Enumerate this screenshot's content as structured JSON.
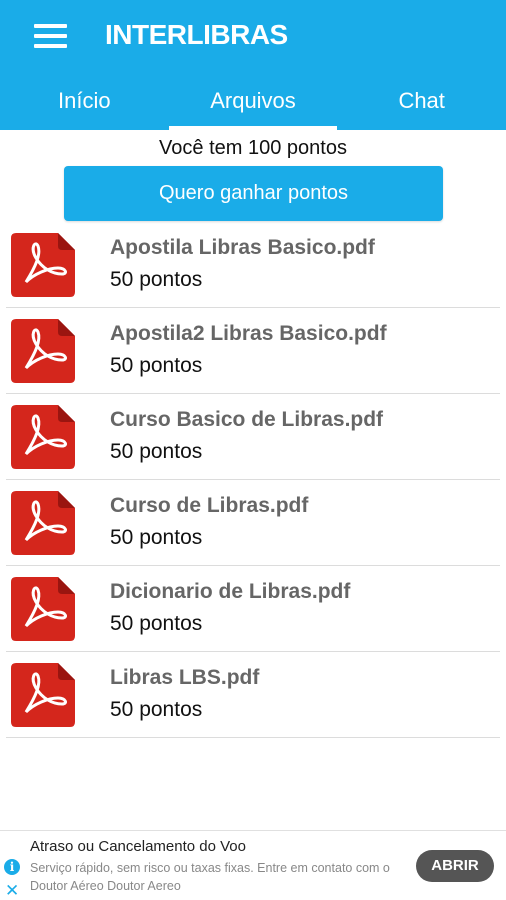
{
  "app": {
    "title": "INTERLIBRAS",
    "menu_icon": "hamburger-menu-icon"
  },
  "tabs": [
    {
      "label": "Início",
      "active": false
    },
    {
      "label": "Arquivos",
      "active": true
    },
    {
      "label": "Chat",
      "active": false
    }
  ],
  "points": {
    "text": "Você tem 100 pontos",
    "button_label": "Quero ganhar pontos"
  },
  "files": [
    {
      "name": "Apostila Libras Basico.pdf",
      "cost": "50 pontos",
      "icon": "pdf-file-icon"
    },
    {
      "name": "Apostila2 Libras Basico.pdf",
      "cost": "50 pontos",
      "icon": "pdf-file-icon"
    },
    {
      "name": "Curso Basico de Libras.pdf",
      "cost": "50 pontos",
      "icon": "pdf-file-icon"
    },
    {
      "name": "Curso de Libras.pdf",
      "cost": "50 pontos",
      "icon": "pdf-file-icon"
    },
    {
      "name": "Dicionario de Libras.pdf",
      "cost": "50 pontos",
      "icon": "pdf-file-icon"
    },
    {
      "name": "Libras LBS.pdf",
      "cost": "50 pontos",
      "icon": "pdf-file-icon"
    }
  ],
  "ad": {
    "title": "Atraso ou Cancelamento do Voo",
    "description": "Serviço rápido, sem risco ou taxas fixas. Entre em contato com o Doutor Aéreo Doutor Aereo",
    "button_label": "ABRIR",
    "info_icon": "info-icon",
    "close_icon": "close-icon"
  },
  "colors": {
    "primary": "#1aace8",
    "pdf_red": "#d4261c",
    "text_gray": "#666666"
  }
}
